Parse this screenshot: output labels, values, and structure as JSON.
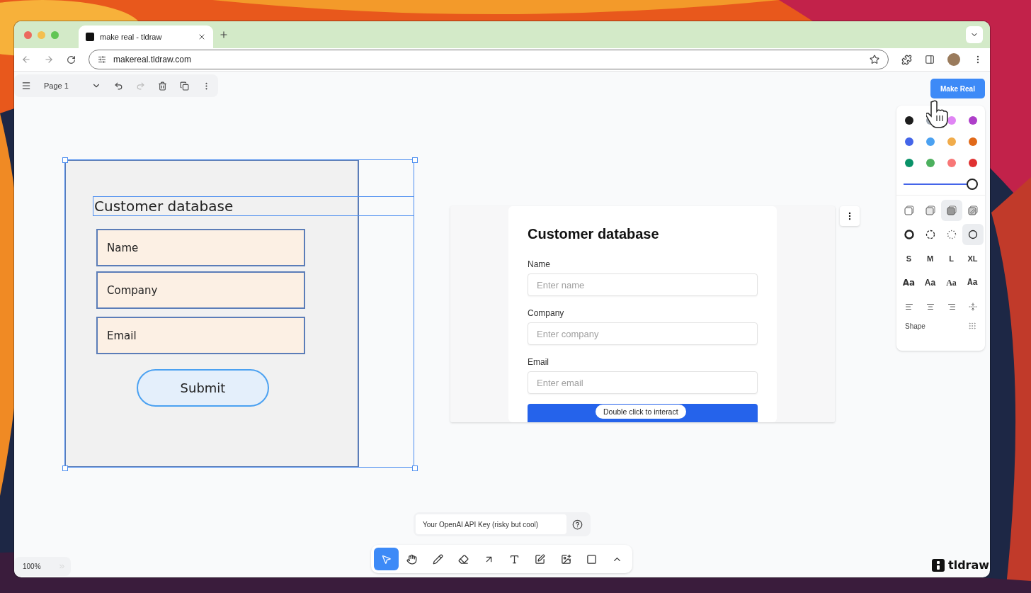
{
  "browser": {
    "tab": {
      "title": "make real - tldraw"
    },
    "url": "makereal.tldraw.com"
  },
  "menu": {
    "page": "Page 1"
  },
  "make_real_button": "Make Real",
  "style_panel": {
    "colors": [
      {
        "color": "#1d1d1d"
      },
      {
        "color": "#9fa8b2"
      },
      {
        "color": "#e085f4"
      },
      {
        "color": "#ae3ec9"
      },
      {
        "color": "#4465e9"
      },
      {
        "color": "#4ba1f1"
      },
      {
        "color": "#f1ac4b"
      },
      {
        "color": "#e16919"
      },
      {
        "color": "#099268"
      },
      {
        "color": "#4cb05e"
      },
      {
        "color": "#f87777"
      },
      {
        "color": "#e03131"
      }
    ],
    "opacity": {
      "level": 1
    },
    "fills": [
      {
        "kind": "none",
        "selected": false
      },
      {
        "kind": "semi",
        "selected": false
      },
      {
        "kind": "solid",
        "selected": true
      },
      {
        "kind": "pattern",
        "selected": false
      }
    ],
    "dashes": [
      {
        "kind": "draw",
        "selected": false
      },
      {
        "kind": "dashed",
        "selected": false
      },
      {
        "kind": "dotted",
        "selected": false
      },
      {
        "kind": "solid",
        "selected": true
      }
    ],
    "sizes": [
      "S",
      "M",
      "L",
      "XL"
    ],
    "fonts": [
      {
        "kind": "draw",
        "label": "Aa"
      },
      {
        "kind": "sans",
        "label": "Aa"
      },
      {
        "kind": "serif",
        "label": "Aa"
      },
      {
        "kind": "mono",
        "label": "Aa"
      }
    ],
    "aligns": [
      {
        "kind": "start"
      },
      {
        "kind": "middle"
      },
      {
        "kind": "end"
      },
      {
        "kind": "vertical"
      }
    ],
    "section_label": "Shape"
  },
  "sketch": {
    "title": "Customer database",
    "fields": [
      "Name",
      "Company",
      "Email"
    ],
    "button": "Submit"
  },
  "preview": {
    "title": "Customer database",
    "fields": [
      {
        "label": "Name",
        "placeholder": "Enter name"
      },
      {
        "label": "Company",
        "placeholder": "Enter company"
      },
      {
        "label": "Email",
        "placeholder": "Enter email"
      }
    ],
    "hint": "Double click to interact"
  },
  "api_key": {
    "placeholder": "Your OpenAI API Key (risky but cool)"
  },
  "tools": [
    {
      "kind": "select",
      "selected": true
    },
    {
      "kind": "hand",
      "selected": false
    },
    {
      "kind": "draw",
      "selected": false
    },
    {
      "kind": "eraser",
      "selected": false
    },
    {
      "kind": "arrow",
      "selected": false
    },
    {
      "kind": "text",
      "selected": false
    },
    {
      "kind": "note",
      "selected": false
    },
    {
      "kind": "asset",
      "selected": false
    },
    {
      "kind": "rectangle",
      "selected": false
    },
    {
      "kind": "more",
      "selected": false
    }
  ],
  "zoom": "100%",
  "logo": "tldraw"
}
